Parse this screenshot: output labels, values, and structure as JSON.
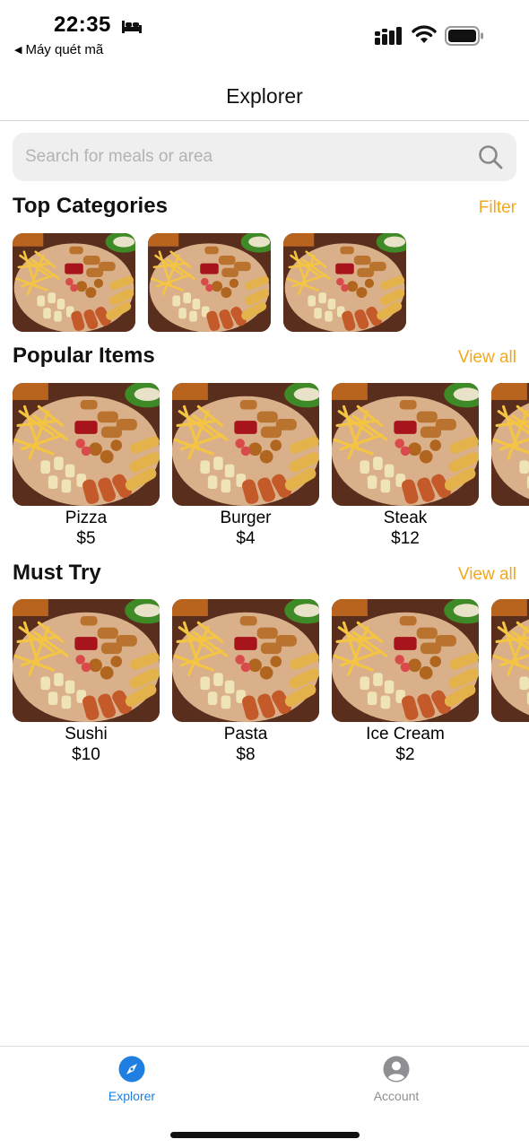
{
  "status_bar": {
    "time": "22:35",
    "back_app": "Máy quét mã",
    "icons": [
      "bed-icon",
      "cellular-signal-icon",
      "wifi-icon",
      "battery-icon"
    ]
  },
  "nav": {
    "title": "Explorer"
  },
  "search": {
    "placeholder": "Search for meals or area",
    "value": "",
    "icon": "search-icon"
  },
  "top_categories": {
    "title": "Top Categories",
    "action": "Filter",
    "count": 3
  },
  "popular_items": {
    "title": "Popular Items",
    "action": "View all",
    "items": [
      {
        "name": "Pizza",
        "price": "$5"
      },
      {
        "name": "Burger",
        "price": "$4"
      },
      {
        "name": "Steak",
        "price": "$12"
      },
      {
        "name": "",
        "price": ""
      }
    ]
  },
  "must_try": {
    "title": "Must Try",
    "action": "View all",
    "items": [
      {
        "name": "Sushi",
        "price": "$10"
      },
      {
        "name": "Pasta",
        "price": "$8"
      },
      {
        "name": "Ice Cream",
        "price": "$2"
      },
      {
        "name": "",
        "price": ""
      }
    ]
  },
  "tab_bar": {
    "tabs": [
      {
        "label": "Explorer",
        "icon": "compass-icon",
        "active": true
      },
      {
        "label": "Account",
        "icon": "account-icon",
        "active": false
      }
    ]
  },
  "colors": {
    "accent": "#f2a81d",
    "active_tab": "#1f7fe0",
    "inactive_tab": "#8e8e93"
  }
}
